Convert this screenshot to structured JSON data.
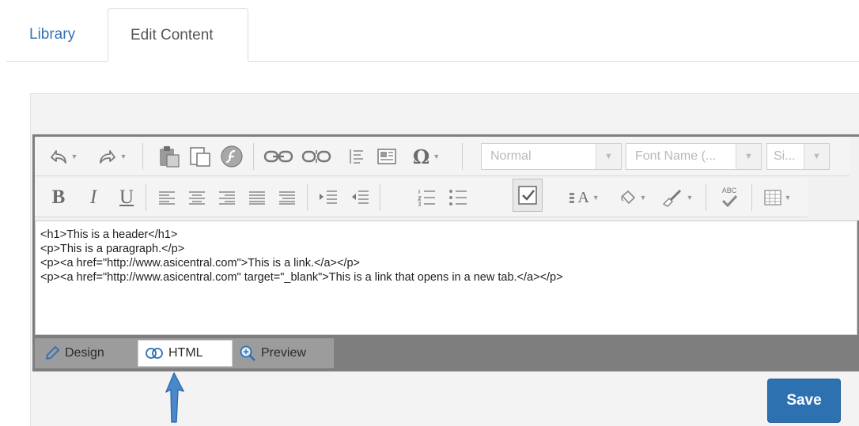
{
  "tabs": {
    "library": "Library",
    "edit_content": "Edit Content"
  },
  "toolbar": {
    "format_placeholder": "Normal",
    "font_name_placeholder": "Font Name (...",
    "size_placeholder": "Si...",
    "bold": "B",
    "italic": "I",
    "underline": "U",
    "special_char": "Ω",
    "spell_abc": "ABC",
    "text_size_label": "A"
  },
  "code_lines": [
    "<h1>This is a header</h1>",
    "<p>This is a paragraph.</p>",
    "<p><a href=\"http://www.asicentral.com\">This is a link.</a></p>",
    "<p><a href=\"http://www.asicentral.com\" target=\"_blank\">This is a link that opens in a new tab.</a></p>"
  ],
  "modes": {
    "design": "Design",
    "html": "HTML",
    "preview": "Preview"
  },
  "save_label": "Save",
  "colors": {
    "link": "#3473b4",
    "save_button": "#2d71b1",
    "annotation_arrow": "#3f7fc4"
  }
}
